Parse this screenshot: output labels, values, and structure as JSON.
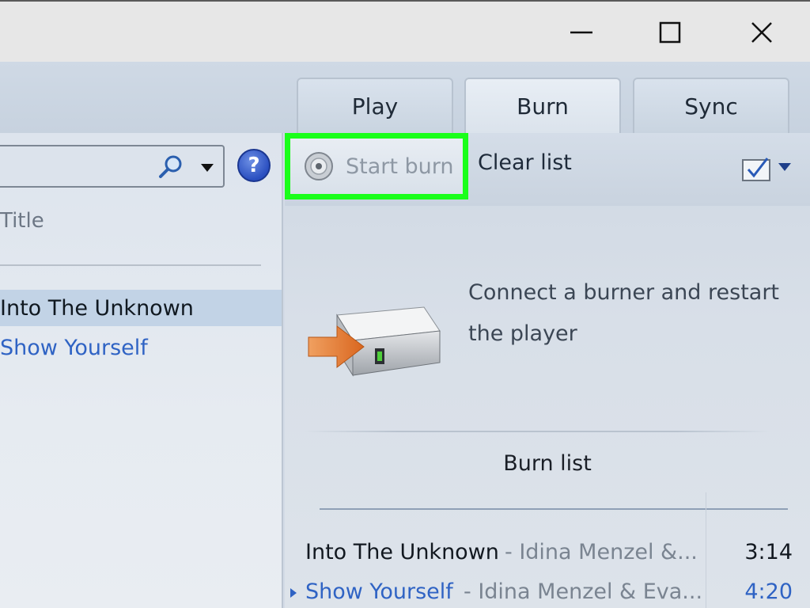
{
  "window": {
    "minimize_icon": "minimize-icon",
    "maximize_icon": "maximize-icon",
    "close_icon": "close-icon"
  },
  "tabs": [
    {
      "label": "Play"
    },
    {
      "label": "Burn"
    },
    {
      "label": "Sync"
    }
  ],
  "library": {
    "column_title": "Title",
    "rows": [
      {
        "title": "Into The Unknown"
      },
      {
        "title": "Show Yourself"
      }
    ]
  },
  "toolbar": {
    "start_burn_label": "Start burn",
    "clear_list_label": "Clear list"
  },
  "burn_panel": {
    "message": "Connect a burner and restart the player",
    "list_title": "Burn list",
    "tracks": [
      {
        "title": "Into The Unknown",
        "artist": "- Idina Menzel &...",
        "duration": "3:14"
      },
      {
        "title": "Show Yourself",
        "artist": "- Idina Menzel & Eva...",
        "duration": "4:20"
      }
    ]
  },
  "colors": {
    "highlight": "#1aff1a",
    "link_blue": "#2f63c4",
    "selected_row": "#c2d3e6"
  }
}
